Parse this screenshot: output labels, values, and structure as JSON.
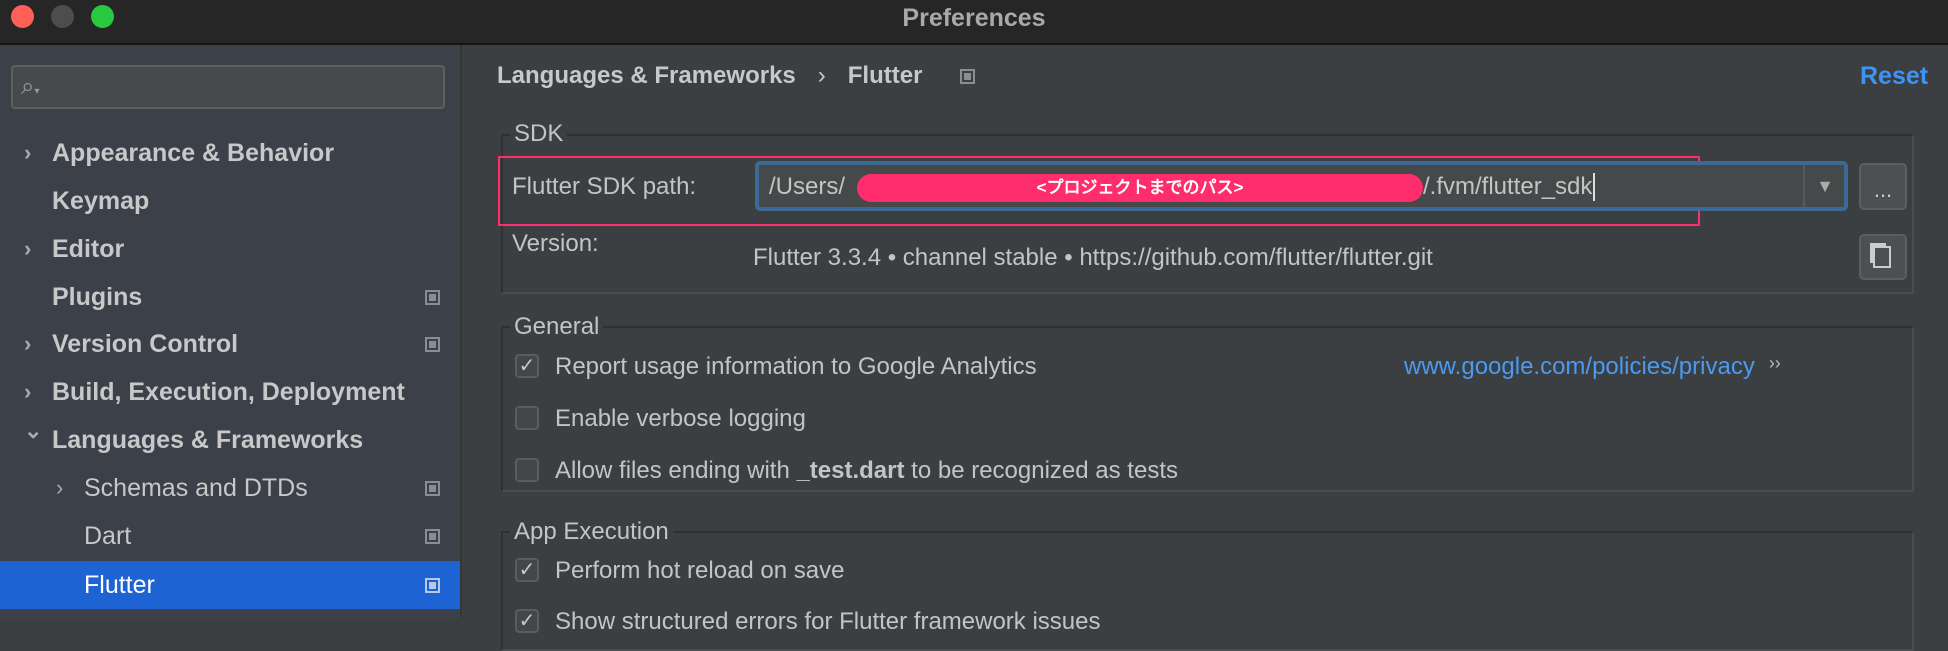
{
  "window": {
    "title": "Preferences",
    "traffic_lights": {
      "close": "#fe5f57",
      "minimize": "#4d4d4d",
      "maximize": "#28c840"
    }
  },
  "sidebar": {
    "search": {
      "placeholder": "",
      "icon": "search-icon"
    },
    "items": [
      {
        "label": "Appearance & Behavior",
        "expandable": true,
        "expanded": false,
        "bold": true,
        "project_icon": false
      },
      {
        "label": "Keymap",
        "expandable": false,
        "bold": true,
        "project_icon": false
      },
      {
        "label": "Editor",
        "expandable": true,
        "expanded": false,
        "bold": true,
        "project_icon": false
      },
      {
        "label": "Plugins",
        "expandable": false,
        "bold": true,
        "project_icon": true
      },
      {
        "label": "Version Control",
        "expandable": true,
        "expanded": false,
        "bold": true,
        "project_icon": true
      },
      {
        "label": "Build, Execution, Deployment",
        "expandable": true,
        "expanded": false,
        "bold": true,
        "project_icon": false
      },
      {
        "label": "Languages & Frameworks",
        "expandable": true,
        "expanded": true,
        "bold": true,
        "project_icon": false
      },
      {
        "label": "Schemas and DTDs",
        "expandable": true,
        "expanded": false,
        "bold": false,
        "project_icon": true,
        "child": true
      },
      {
        "label": "Dart",
        "expandable": false,
        "bold": false,
        "project_icon": true,
        "child": true
      },
      {
        "label": "Flutter",
        "expandable": false,
        "bold": false,
        "project_icon": true,
        "child": true,
        "selected": true
      }
    ],
    "selected_color": "#1d63d4"
  },
  "header": {
    "breadcrumb": [
      "Languages & Frameworks",
      "Flutter"
    ],
    "separator": "›",
    "reset_label": "Reset",
    "accent": "#3d94f6"
  },
  "sdk": {
    "group_label": "SDK",
    "path_label": "Flutter SDK path:",
    "path_prefix": "/Users/",
    "redaction_label": "<プロジェクトまでのパス>",
    "path_suffix": "/.fvm/flutter_sdk",
    "browse_label": "...",
    "version_label": "Version:",
    "version_value": "Flutter 3.3.4 • channel stable • https://github.com/flutter/flutter.git",
    "highlight_color": "#ff2d6b"
  },
  "general": {
    "group_label": "General",
    "options": [
      {
        "label": "Report usage information to Google Analytics",
        "checked": true
      },
      {
        "label": "Enable verbose logging",
        "checked": false
      },
      {
        "label_before": "Allow files ending with ",
        "label_bold": "_test.dart",
        "label_after": " to be recognized as tests",
        "checked": false
      }
    ],
    "privacy_link": "www.google.com/policies/privacy",
    "privacy_arrow": "››"
  },
  "app_execution": {
    "group_label": "App Execution",
    "options": [
      {
        "label": "Perform hot reload on save",
        "checked": true
      },
      {
        "label": "Show structured errors for Flutter framework issues",
        "checked": true
      }
    ]
  }
}
